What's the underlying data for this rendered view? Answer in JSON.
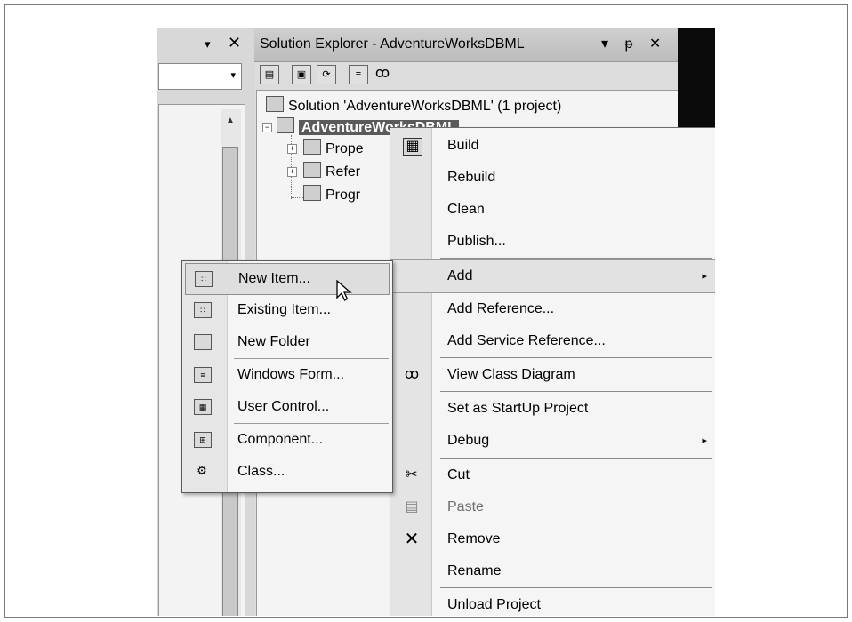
{
  "solution_explorer": {
    "title": "Solution Explorer - AdventureWorksDBML",
    "title_buttons": [
      "▾",
      "ᵽ",
      "✕"
    ],
    "solution_node": "Solution 'AdventureWorksDBML' (1 project)",
    "project_node": "AdventureWorksDBML",
    "children": [
      "Prope",
      "Refer",
      "Progr"
    ]
  },
  "left_pane": {
    "dropdown_glyph": "▾",
    "close_glyph": "✕",
    "combo_arrow": "▾",
    "scroll_up": "▲"
  },
  "context_menu": {
    "items": [
      {
        "label": "Build",
        "icon": "build-icon"
      },
      {
        "label": "Rebuild"
      },
      {
        "label": "Clean"
      },
      {
        "label": "Publish..."
      },
      {
        "label": "Add",
        "submenu_arrow": "▸"
      },
      {
        "label": "Add Reference..."
      },
      {
        "label": "Add Service Reference..."
      },
      {
        "label": "View Class Diagram",
        "icon": "class-diagram-icon"
      },
      {
        "label": "Set as StartUp Project"
      },
      {
        "label": "Debug",
        "submenu_arrow": "▸"
      },
      {
        "label": "Cut",
        "icon": "scissors-icon"
      },
      {
        "label": "Paste",
        "icon": "paste-icon",
        "disabled": true
      },
      {
        "label": "Remove",
        "icon": "delete-x-icon"
      },
      {
        "label": "Rename"
      },
      {
        "label": "Unload Project"
      }
    ]
  },
  "add_submenu": {
    "items": [
      {
        "label": "New Item...",
        "icon": "new-item-icon"
      },
      {
        "label": "Existing Item...",
        "icon": "existing-item-icon"
      },
      {
        "label": "New Folder",
        "icon": "folder-icon"
      },
      {
        "label": "Windows Form...",
        "icon": "windows-form-icon"
      },
      {
        "label": "User Control...",
        "icon": "user-control-icon"
      },
      {
        "label": "Component...",
        "icon": "component-icon"
      },
      {
        "label": "Class...",
        "icon": "class-icon"
      }
    ]
  }
}
